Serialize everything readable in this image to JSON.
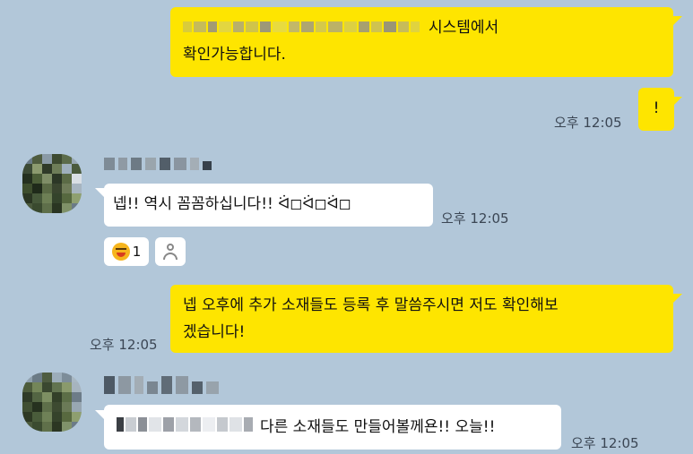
{
  "messages": {
    "m1": {
      "text_line1_suffix": "시스템에서",
      "text_line2": "확인가능합니다."
    },
    "m2": {
      "text": "!",
      "time": "오후 12:05"
    },
    "m3": {
      "text": "넵!! 역시 꼼꼼하십니다!! ᐛ◻ᐛ◻ᐛ◻",
      "time": "오후 12:05",
      "reaction_count": "1"
    },
    "m4": {
      "line1": "넵 오후에 추가 소재들도 등록 후 말씀주시면 저도 확인해보",
      "line2": "겠습니다!",
      "time": "오후 12:05"
    },
    "m5": {
      "text_suffix": "다른 소재들도 만들어볼께욘!! 오늘!!",
      "time": "오후 12:05"
    }
  },
  "icons": {
    "reaction_emoji": "laughing-face-icon",
    "reaction_user": "person-icon"
  },
  "colors": {
    "background": "#b2c7d9",
    "my_bubble": "#fee500",
    "their_bubble": "#ffffff",
    "time_text": "#3b4654"
  }
}
